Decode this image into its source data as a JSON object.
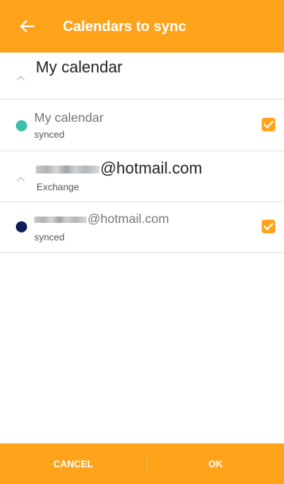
{
  "header": {
    "title": "Calendars to sync",
    "back_icon": "arrow-left-icon"
  },
  "groups": [
    {
      "title": "My calendar",
      "subtitle": "",
      "calendars": [
        {
          "name": "My calendar",
          "status": "synced",
          "color": "#3DBFAE",
          "checked": true
        }
      ]
    },
    {
      "title": "@hotmail.com",
      "subtitle": "Exchange",
      "calendars": [
        {
          "name": "@hotmail.com",
          "status": "synced",
          "color": "#0E1F5C",
          "checked": true
        }
      ]
    }
  ],
  "footer": {
    "cancel_label": "CANCEL",
    "ok_label": "OK"
  },
  "colors": {
    "accent": "#FFA31A"
  }
}
